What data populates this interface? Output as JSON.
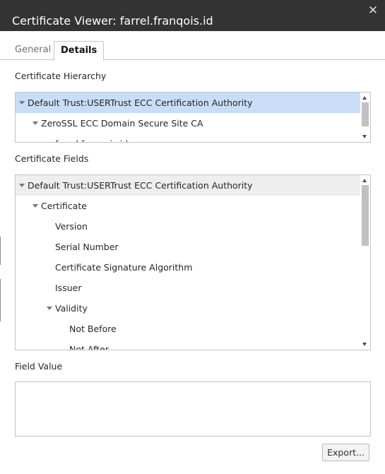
{
  "dialog": {
    "title": "Certificate Viewer: farrel.franqois.id",
    "close_label": "✕"
  },
  "tabs": [
    {
      "label": "General",
      "active": false
    },
    {
      "label": "Details",
      "active": true
    }
  ],
  "hierarchy": {
    "label": "Certificate Hierarchy",
    "items": [
      {
        "label": "Default Trust:USERTrust ECC Certification Authority",
        "selected": true
      },
      {
        "label": "ZeroSSL ECC Domain Secure Site CA",
        "selected": false
      },
      {
        "label": "farrel.franqois.id",
        "selected": false
      }
    ]
  },
  "fields": {
    "label": "Certificate Fields",
    "items": [
      {
        "label": "Default Trust:USERTrust ECC Certification Authority"
      },
      {
        "label": "Certificate"
      },
      {
        "label": "Version"
      },
      {
        "label": "Serial Number"
      },
      {
        "label": "Certificate Signature Algorithm"
      },
      {
        "label": "Issuer"
      },
      {
        "label": "Validity"
      },
      {
        "label": "Not Before"
      },
      {
        "label": "Not After"
      }
    ]
  },
  "field_value": {
    "label": "Field Value",
    "value": ""
  },
  "export_label": "Export...",
  "colors": {
    "titlebar": "#333333",
    "selection": "#c9ddf6",
    "hover": "#eeeeee"
  }
}
